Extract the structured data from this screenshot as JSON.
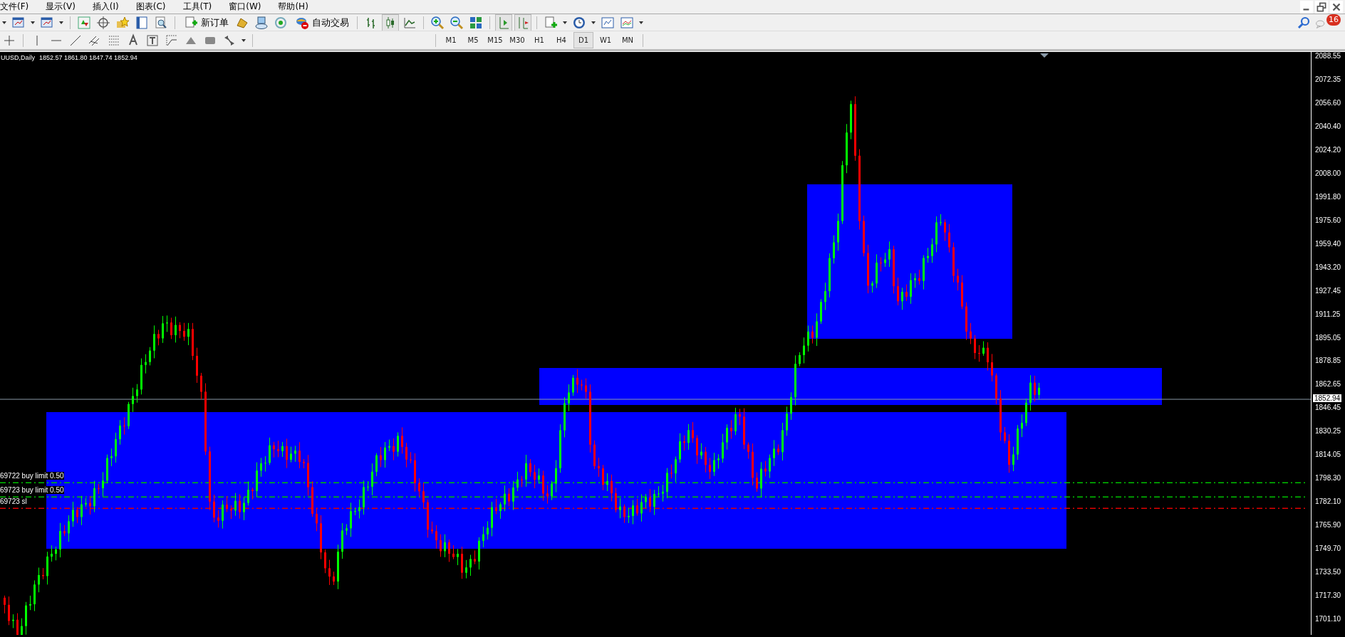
{
  "menu": [
    {
      "label": "文件(F)"
    },
    {
      "label": "显示(V)"
    },
    {
      "label": "插入(I)"
    },
    {
      "label": "图表(C)"
    },
    {
      "label": "工具(T)"
    },
    {
      "label": "窗口(W)"
    },
    {
      "label": "帮助(H)"
    }
  ],
  "toolbar": {
    "new_order": "新订单",
    "auto_trading": "自动交易"
  },
  "timeframes": [
    {
      "label": "M1",
      "selected": false
    },
    {
      "label": "M5",
      "selected": false
    },
    {
      "label": "M15",
      "selected": false
    },
    {
      "label": "M30",
      "selected": false
    },
    {
      "label": "H1",
      "selected": false
    },
    {
      "label": "H4",
      "selected": false
    },
    {
      "label": "D1",
      "selected": true
    },
    {
      "label": "W1",
      "selected": false
    },
    {
      "label": "MN",
      "selected": false
    }
  ],
  "notifications": {
    "count": "16"
  },
  "chart": {
    "symbol": "UUSD,Daily",
    "ohlc": "1852.57 1861.80 1847.74 1852.94",
    "current_price": "1852.94",
    "price_axis": [
      "2088.55",
      "2072.35",
      "2056.60",
      "2040.40",
      "2024.20",
      "2008.00",
      "1991.80",
      "1975.60",
      "1959.40",
      "1943.20",
      "1927.45",
      "1911.25",
      "1895.05",
      "1878.85",
      "1862.65",
      "1846.45",
      "1830.25",
      "1814.05",
      "1798.30",
      "1782.10",
      "1765.90",
      "1749.70",
      "1733.50",
      "1717.30",
      "1701.10"
    ],
    "orders": [
      {
        "label": "69722 buy limit 0.50",
        "color": "#00c000"
      },
      {
        "label": "69723 buy limit 0.50",
        "color": "#00c000"
      },
      {
        "label": "69723 sl",
        "color": "#e00000"
      }
    ]
  }
}
